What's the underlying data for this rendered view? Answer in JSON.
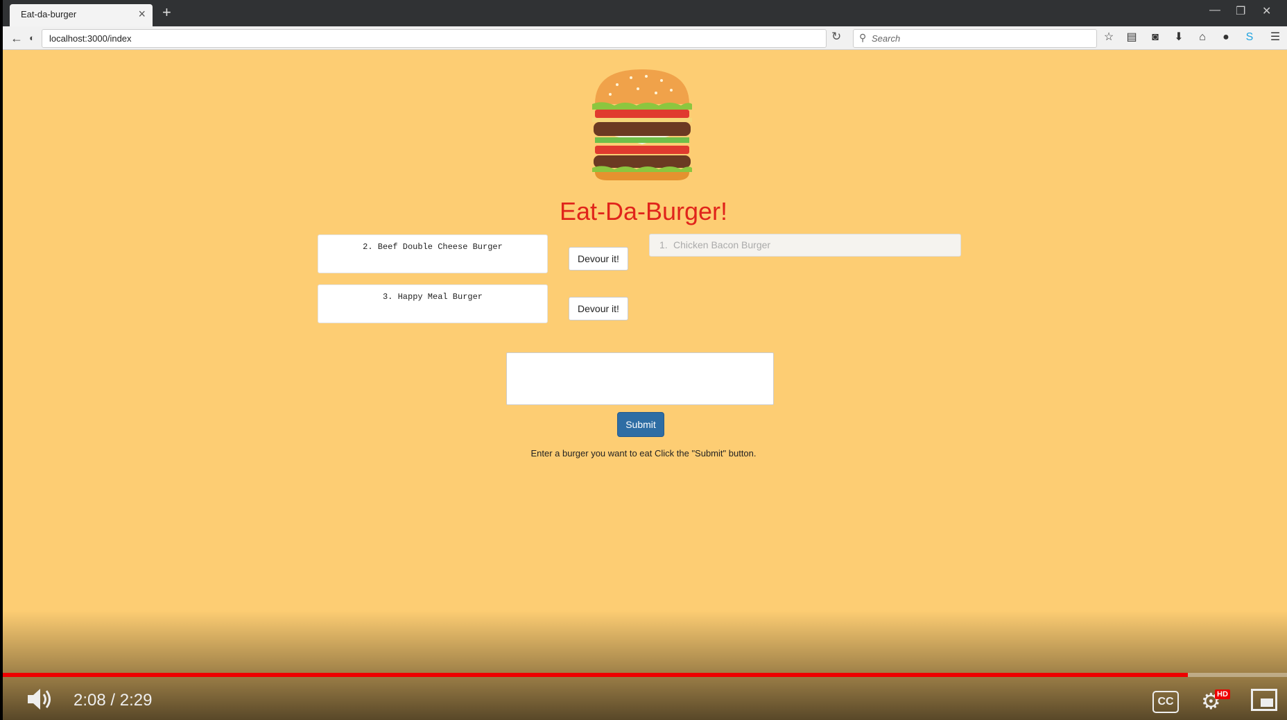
{
  "browser": {
    "tab_title": "Eat-da-burger",
    "url": "localhost:3000/index",
    "search_placeholder": "Search"
  },
  "page": {
    "heading": "Eat-Da-Burger!",
    "burgers": [
      {
        "label": "2. Beef Double Cheese Burger",
        "button": "Devour it!"
      },
      {
        "label": "3. Happy Meal Burger",
        "button": "Devour it!"
      }
    ],
    "devoured": [
      {
        "number": "1.",
        "name": "Chicken Bacon Burger"
      }
    ],
    "textarea_value": "",
    "submit_label": "Submit",
    "instructions": "Enter a burger you want to eat Click the \"Submit\" button."
  },
  "video": {
    "time": "2:08 / 2:29",
    "progress": 0.923,
    "cc_label": "CC",
    "hd_label": "HD"
  }
}
